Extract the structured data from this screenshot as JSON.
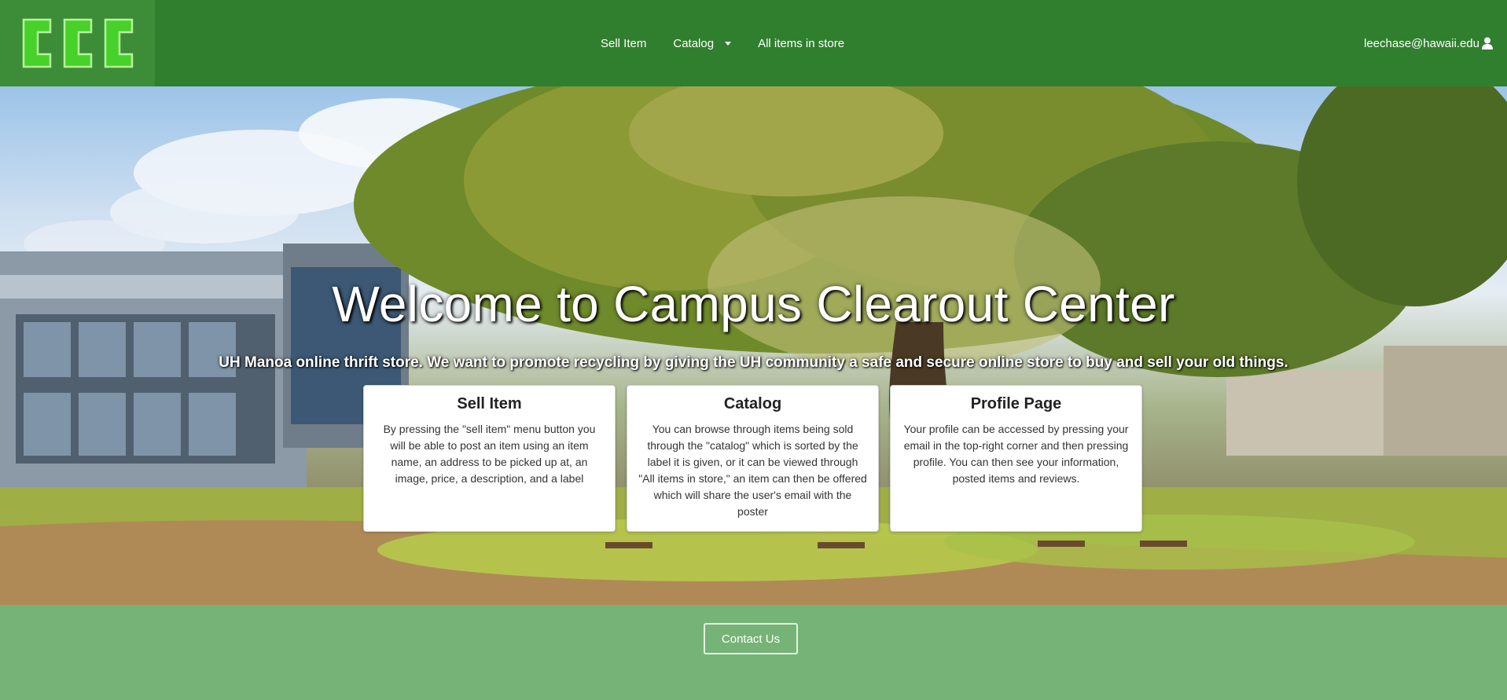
{
  "navbar": {
    "logo_text": "CCC",
    "items": [
      {
        "label": "Sell Item"
      },
      {
        "label": "Catalog"
      },
      {
        "label": "All items in store"
      }
    ],
    "user_email": "leechase@hawaii.edu",
    "colors": {
      "bar": "#307f2e",
      "logo_bg": "#3d8c38",
      "logo_fill": "#47d12a"
    }
  },
  "hero": {
    "title": "Welcome to Campus Clearout Center",
    "subtitle": "UH Manoa online thrift store. We want to promote recycling by giving the UH community a safe and secure online store to buy and sell your old things.",
    "cards": [
      {
        "title": "Sell Item",
        "body": "By pressing the \"sell item\" menu button you will be able to post an item using an item name, an address to be picked up at, an image, price, a description, and a label"
      },
      {
        "title": "Catalog",
        "body": "You can browse through items being sold through the \"catalog\" which is sorted by the label it is given, or it can be viewed through \"All items in store,\" an item can then be offered which will share the user's email with the poster"
      },
      {
        "title": "Profile Page",
        "body": "Your profile can be accessed by pressing your email in the top-right corner and then pressing profile. You can then see your information, posted items and reviews."
      }
    ]
  },
  "footer": {
    "contact_label": "Contact Us",
    "bg_color": "#76b376"
  }
}
